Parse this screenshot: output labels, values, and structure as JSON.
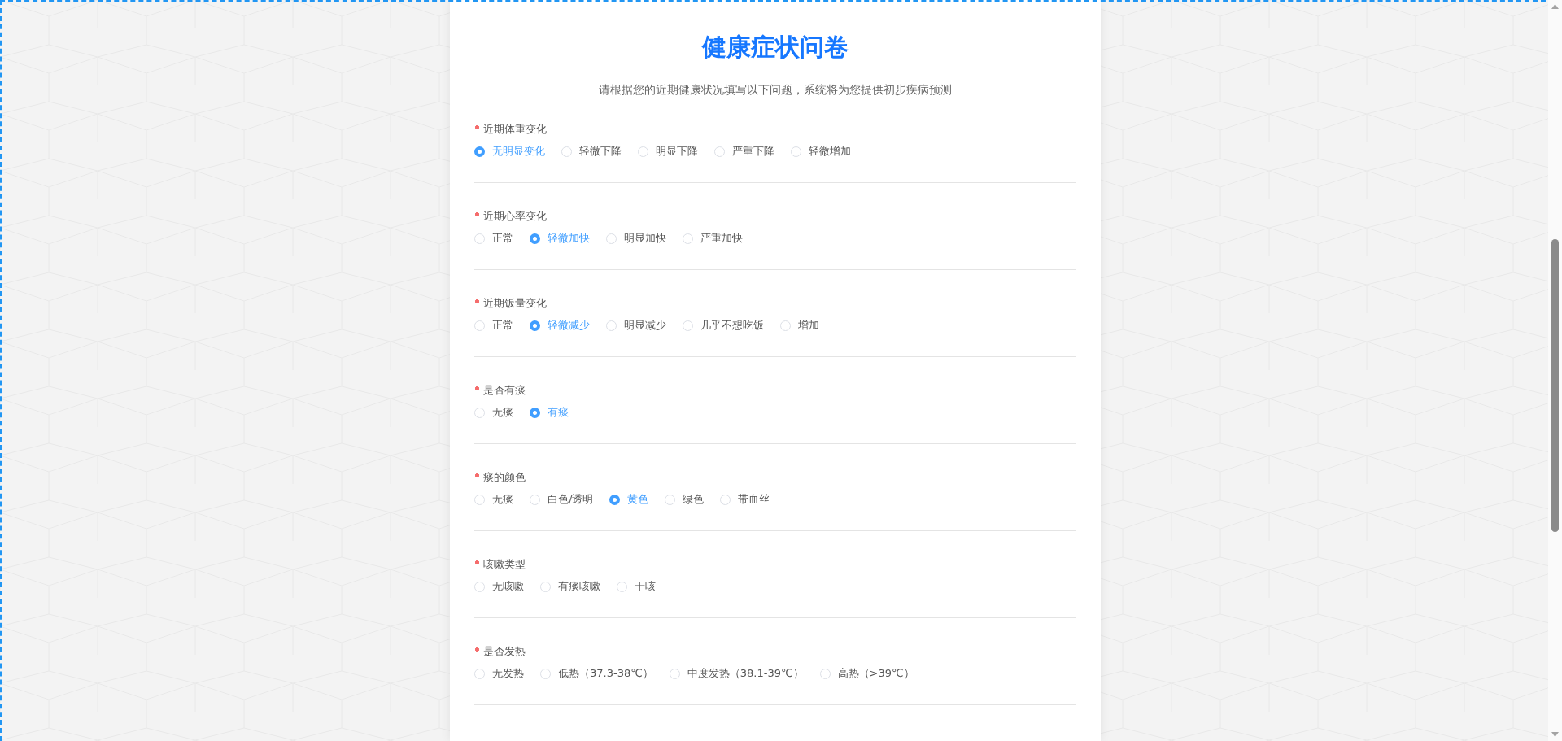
{
  "title": "健康症状问卷",
  "subtitle": "请根据您的近期健康状况填写以下问题，系统将为您提供初步疾病预测",
  "questions": [
    {
      "required": true,
      "label": "近期体重变化",
      "options": [
        {
          "label": "无明显变化",
          "selected": true
        },
        {
          "label": "轻微下降",
          "selected": false
        },
        {
          "label": "明显下降",
          "selected": false
        },
        {
          "label": "严重下降",
          "selected": false
        },
        {
          "label": "轻微增加",
          "selected": false
        }
      ]
    },
    {
      "required": true,
      "label": "近期心率变化",
      "options": [
        {
          "label": "正常",
          "selected": false
        },
        {
          "label": "轻微加快",
          "selected": true
        },
        {
          "label": "明显加快",
          "selected": false
        },
        {
          "label": "严重加快",
          "selected": false
        }
      ]
    },
    {
      "required": true,
      "label": "近期饭量变化",
      "options": [
        {
          "label": "正常",
          "selected": false
        },
        {
          "label": "轻微减少",
          "selected": true
        },
        {
          "label": "明显减少",
          "selected": false
        },
        {
          "label": "几乎不想吃饭",
          "selected": false
        },
        {
          "label": "增加",
          "selected": false
        }
      ]
    },
    {
      "required": true,
      "label": "是否有痰",
      "options": [
        {
          "label": "无痰",
          "selected": false
        },
        {
          "label": "有痰",
          "selected": true
        }
      ]
    },
    {
      "required": true,
      "label": "痰的颜色",
      "options": [
        {
          "label": "无痰",
          "selected": false
        },
        {
          "label": "白色/透明",
          "selected": false
        },
        {
          "label": "黄色",
          "selected": true
        },
        {
          "label": "绿色",
          "selected": false
        },
        {
          "label": "带血丝",
          "selected": false
        }
      ]
    },
    {
      "required": true,
      "label": "咳嗽类型",
      "options": [
        {
          "label": "无咳嗽",
          "selected": false
        },
        {
          "label": "有痰咳嗽",
          "selected": false
        },
        {
          "label": "干咳",
          "selected": false
        }
      ]
    },
    {
      "required": true,
      "label": "是否发热",
      "options": [
        {
          "label": "无发热",
          "selected": false
        },
        {
          "label": "低热（37.3-38℃）",
          "selected": false
        },
        {
          "label": "中度发热（38.1-39℃）",
          "selected": false
        },
        {
          "label": "高热（>39℃）",
          "selected": false
        }
      ]
    }
  ]
}
